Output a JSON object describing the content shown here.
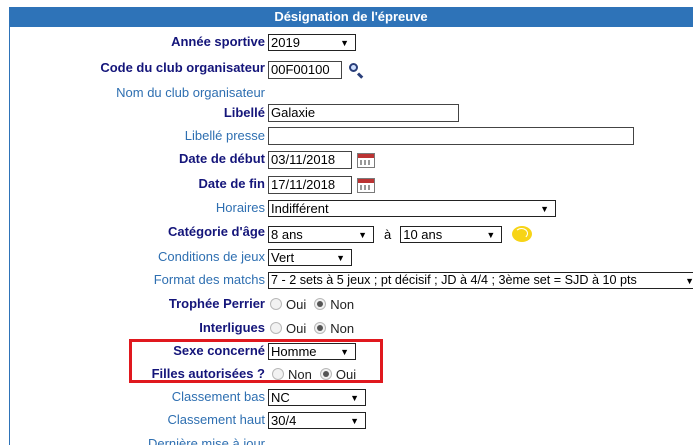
{
  "header": {
    "title": "Désignation de l'épreuve"
  },
  "fields": {
    "annee": {
      "label": "Année sportive",
      "value": "2019"
    },
    "code_club": {
      "label": "Code du club organisateur",
      "value": "00F00100"
    },
    "nom_club": {
      "label": "Nom du club organisateur"
    },
    "libelle": {
      "label": "Libellé",
      "value": "Galaxie"
    },
    "libelle_presse": {
      "label": "Libellé presse",
      "value": ""
    },
    "date_debut": {
      "label": "Date de début",
      "value": "03/11/2018"
    },
    "date_fin": {
      "label": "Date de fin",
      "value": "17/11/2018"
    },
    "horaires": {
      "label": "Horaires",
      "value": "Indifférent"
    },
    "categorie": {
      "label": "Catégorie d'âge",
      "from": "8 ans",
      "sep": "à",
      "to": "10 ans"
    },
    "conditions": {
      "label": "Conditions de jeux",
      "value": "Vert"
    },
    "format": {
      "label": "Format des matchs",
      "value": "7 - 2 sets à 5 jeux ; pt décisif ; JD à 4/4 ; 3ème set = SJD à 10 pts"
    },
    "trophee": {
      "label": "Trophée Perrier",
      "opt1": "Oui",
      "opt2": "Non",
      "selected": "Non"
    },
    "interligues": {
      "label": "Interligues",
      "opt1": "Oui",
      "opt2": "Non",
      "selected": "Non"
    },
    "sexe": {
      "label": "Sexe concerné",
      "value": "Homme"
    },
    "filles": {
      "label": "Filles autorisées ?",
      "opt1": "Non",
      "opt2": "Oui",
      "selected": "Oui"
    },
    "class_bas": {
      "label": "Classement bas",
      "value": "NC"
    },
    "class_haut": {
      "label": "Classement haut",
      "value": "30/4"
    },
    "maj": {
      "label": "Dernière mise à jour"
    }
  },
  "icons": {
    "search": "magnifier-icon",
    "calendar": "calendar-icon",
    "tennis": "tennis-ball-icon"
  },
  "colors": {
    "header_bg": "#2e73b8",
    "required_label": "#14157a",
    "optional_label": "#2e6fb1",
    "highlight": "#e0181e"
  }
}
